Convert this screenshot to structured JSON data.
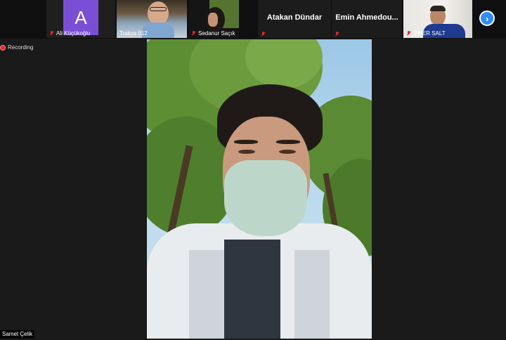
{
  "participants": [
    {
      "name": "Ali Küçükoğlu",
      "initial": "A",
      "muted": true
    },
    {
      "name": "Trakya 012",
      "muted": false
    },
    {
      "name": "Sedanur Saçık",
      "muted": true
    },
    {
      "name": "Atakan Dündar",
      "muted": true
    },
    {
      "name": "Emin Ahmedou...",
      "muted": true
    },
    {
      "name": "ÖMER SALT",
      "muted": true
    }
  ],
  "next_button": {
    "icon": "chevron-right-icon",
    "label": "›"
  },
  "recording": {
    "label": "Recording"
  },
  "active_speaker": {
    "name": "Samet Çelik"
  },
  "colors": {
    "accent": "#2d8cff",
    "avatar": "#7a4fd6",
    "muted": "#e02828"
  }
}
